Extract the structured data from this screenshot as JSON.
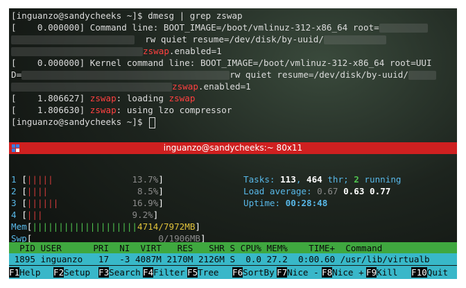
{
  "terminal1": {
    "lines": [
      {
        "t1": "[inguanzo@sandycheeks ~]$ dmesg | grep zswap"
      },
      {
        "t1": "[    0.000000] Command line: BOOT_IMAGE=/boot/vmlinuz-312-x86_64 root="
      },
      {
        "t1": "rw quiet resume=/dev/disk/by-uuid/"
      },
      {
        "r": "zswap",
        "t2": ".enabled=1"
      },
      {
        "t1": "[    0.000000] Kernel command line: BOOT_IMAGE=/boot/vmlinuz-312-x86_64 root=UUI"
      },
      {
        "t1": "D="
      },
      {
        "t1": "rw quiet resume=/dev/disk/by-uuid/"
      },
      {
        "r": "zswap",
        "t2": ".enabled=1"
      },
      {
        "t1": "[    1.806627] ",
        "r": "zswap",
        "t2": ": loading ",
        "r2": "zswap"
      },
      {
        "t1": "[    1.806630] ",
        "r": "zswap",
        "t2": ": using lzo compressor"
      },
      {
        "t1": "[inguanzo@sandycheeks ~]$ "
      }
    ]
  },
  "window": {
    "title": "inguanzo@sandycheeks:~ 80x11"
  },
  "htop": {
    "cpus": [
      {
        "label": "1",
        "bars": "|||||",
        "pct": "13.7%",
        "color": "#d23a3a"
      },
      {
        "label": "2",
        "bars": "||||",
        "pct": "8.5%",
        "color": "#d23a3a"
      },
      {
        "label": "3",
        "bars": "||||||",
        "pct": "16.9%",
        "color": "#d23a3a"
      },
      {
        "label": "4",
        "bars": "|||",
        "pct": "9.2%",
        "color": "#d23a3a"
      }
    ],
    "mem": {
      "label": "Mem",
      "bars": "||||||||||||||||||||",
      "value": "4714/7972MB"
    },
    "swp": {
      "label": "Swp",
      "value": "0/1906MB"
    },
    "tasks": {
      "label": "Tasks: ",
      "count": "113",
      "sep": ", ",
      "thr": "464",
      "thr_label": " thr; ",
      "running": "2",
      "running_label": " running"
    },
    "load": {
      "label": "Load average: ",
      "v1": "0.67",
      "v2": "0.63",
      "v3": "0.77"
    },
    "uptime": {
      "label": "Uptime: ",
      "value": "00:28:48"
    },
    "header": "  PID USER      PRI  NI  VIRT   RES   SHR S CPU% MEM%    TIME+  Command",
    "process": " 1895 inguanzo   17  -3 4087M 2170M 2126M S  0.0 27.2  0:00.60 /usr/lib/virtualb",
    "fkeys": [
      {
        "key": "F1",
        "label": "Help"
      },
      {
        "key": "F2",
        "label": "Setup"
      },
      {
        "key": "F3",
        "label": "Search"
      },
      {
        "key": "F4",
        "label": "Filter"
      },
      {
        "key": "F5",
        "label": "Tree"
      },
      {
        "key": "F6",
        "label": "SortBy"
      },
      {
        "key": "F7",
        "label": "Nice -"
      },
      {
        "key": "F8",
        "label": "Nice +"
      },
      {
        "key": "F9",
        "label": "Kill"
      },
      {
        "key": "F10",
        "label": "Quit"
      }
    ]
  }
}
